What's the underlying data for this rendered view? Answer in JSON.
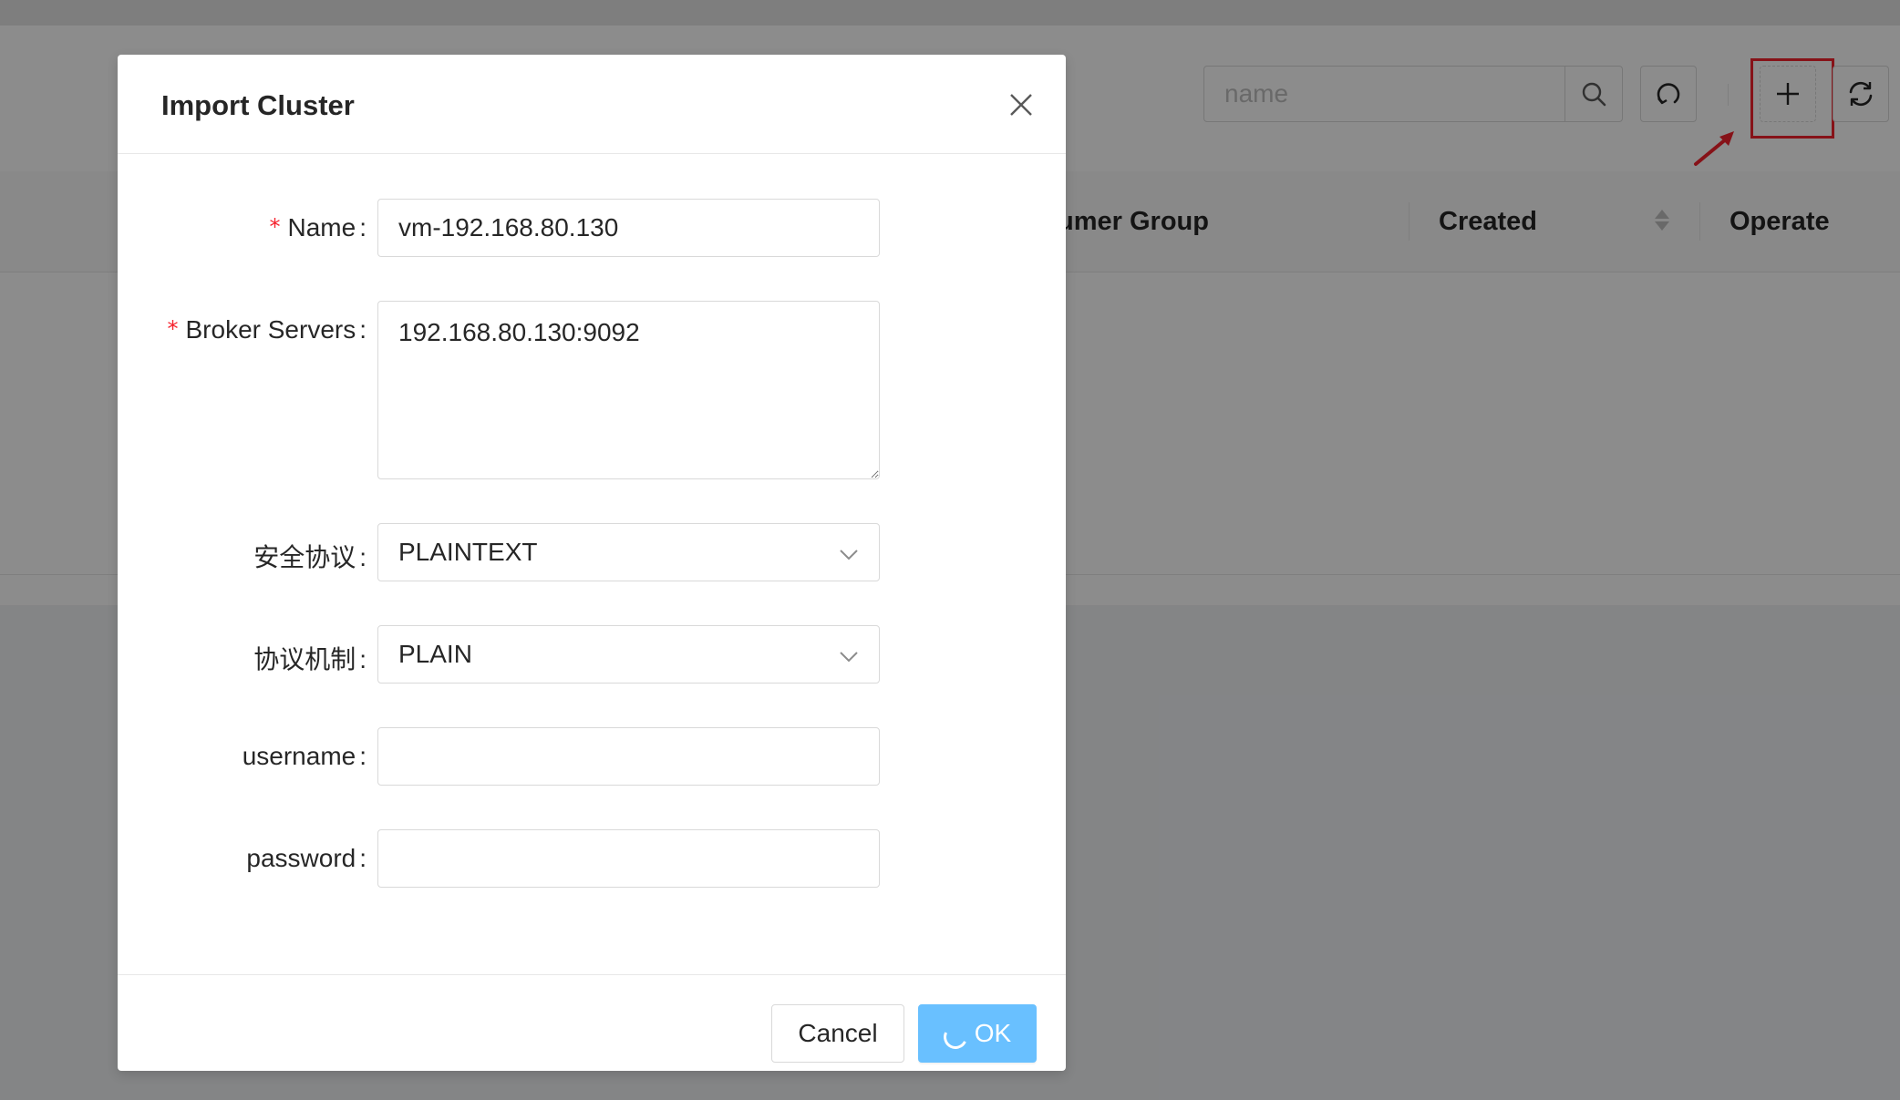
{
  "background": {
    "search": {
      "placeholder": "name"
    },
    "table": {
      "headers": [
        "umer Group",
        "Created",
        "Operate"
      ]
    },
    "toolbar": {
      "search_icon": "search-icon",
      "reset_icon": "reset-icon",
      "add_icon": "plus-icon",
      "refresh_icon": "refresh-icon"
    }
  },
  "modal": {
    "title": "Import Cluster",
    "fields": {
      "name": {
        "label": "Name",
        "value": "vm-192.168.80.130",
        "required": true
      },
      "broker_servers": {
        "label": "Broker Servers",
        "value": "192.168.80.130:9092",
        "required": true
      },
      "security_protocol": {
        "label": "安全协议",
        "value": "PLAINTEXT"
      },
      "sasl_mechanism": {
        "label": "协议机制",
        "value": "PLAIN"
      },
      "username": {
        "label": "username",
        "value": ""
      },
      "password": {
        "label": "password",
        "value": ""
      }
    },
    "footer": {
      "cancel_label": "Cancel",
      "ok_label": "OK"
    }
  },
  "colors": {
    "primary_light": "#69c0ff",
    "highlight": "#f5222d",
    "mask": "rgba(0,0,0,0.45)"
  }
}
